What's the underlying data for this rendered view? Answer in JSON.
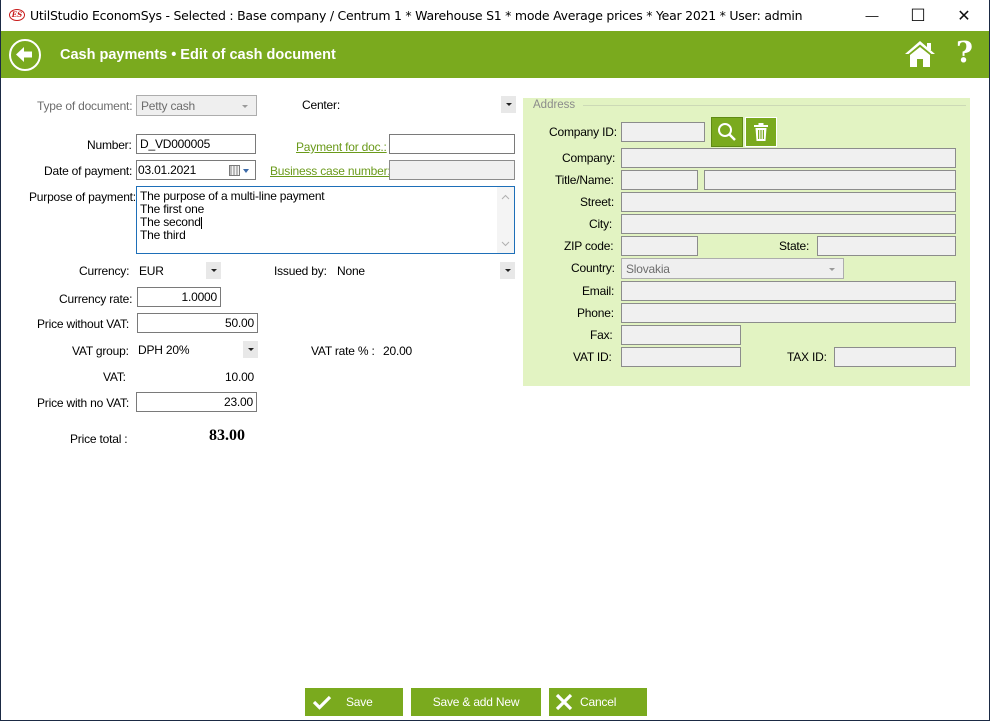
{
  "window": {
    "logo": "ES",
    "title": "UtilStudio EconomSys - Selected : Base company / Centrum 1 * Warehouse S1 * mode Average prices * Year 2021 * User: admin",
    "minimize": "—",
    "maximize": "☐",
    "close": "✕"
  },
  "header": {
    "title": "Cash payments • Edit of cash document",
    "help": "?"
  },
  "form": {
    "type_of_document": {
      "label": "Type of document:",
      "value": "Petty cash"
    },
    "center": {
      "label": "Center:",
      "value": ""
    },
    "number": {
      "label": "Number:",
      "value": "D_VD000005"
    },
    "payment_for_doc": {
      "label": "Payment for doc.:",
      "value": ""
    },
    "date_of_payment": {
      "label": "Date of payment:",
      "value": "03.01.2021"
    },
    "business_case_number": {
      "label": "Business case number:",
      "value": ""
    },
    "purpose_of_payment": {
      "label": "Purpose of payment:",
      "lines": [
        "The purpose of a multi-line payment",
        "The first one",
        "The second",
        "The third"
      ]
    },
    "currency": {
      "label": "Currency:",
      "value": "EUR"
    },
    "issued_by": {
      "label": "Issued by:",
      "value": "None"
    },
    "currency_rate": {
      "label": "Currency rate:",
      "value": "1.0000"
    },
    "price_without_vat": {
      "label": "Price without VAT:",
      "value": "50.00"
    },
    "vat_group": {
      "label": "VAT group:",
      "value": "DPH 20%"
    },
    "vat_rate": {
      "label": "VAT rate % :",
      "value": "20.00"
    },
    "vat": {
      "label": "VAT:",
      "value": "10.00"
    },
    "price_with_no_vat": {
      "label": "Price with no VAT:",
      "value": "23.00"
    },
    "price_total": {
      "label": "Price total :",
      "value": "83.00"
    }
  },
  "address": {
    "legend": "Address",
    "company_id": {
      "label": "Company ID:",
      "value": ""
    },
    "company": {
      "label": "Company:",
      "value": ""
    },
    "title_name": {
      "label": "Title/Name:",
      "title": "",
      "name": ""
    },
    "street": {
      "label": "Street:",
      "value": ""
    },
    "city": {
      "label": "City:",
      "value": ""
    },
    "zip": {
      "label": "ZIP code:",
      "value": ""
    },
    "state": {
      "label": "State:",
      "value": ""
    },
    "country": {
      "label": "Country:",
      "value": "Slovakia"
    },
    "email": {
      "label": "Email:",
      "value": ""
    },
    "phone": {
      "label": "Phone:",
      "value": ""
    },
    "fax": {
      "label": "Fax:",
      "value": ""
    },
    "vat_id": {
      "label": "VAT ID:",
      "value": ""
    },
    "tax_id": {
      "label": "TAX ID:",
      "value": ""
    }
  },
  "buttons": {
    "save": "Save",
    "save_add_new": "Save & add New",
    "cancel": "Cancel"
  },
  "colors": {
    "accent": "#7aaa1e",
    "address_panel": "#e2f3c2",
    "link": "#6a9a1a"
  }
}
